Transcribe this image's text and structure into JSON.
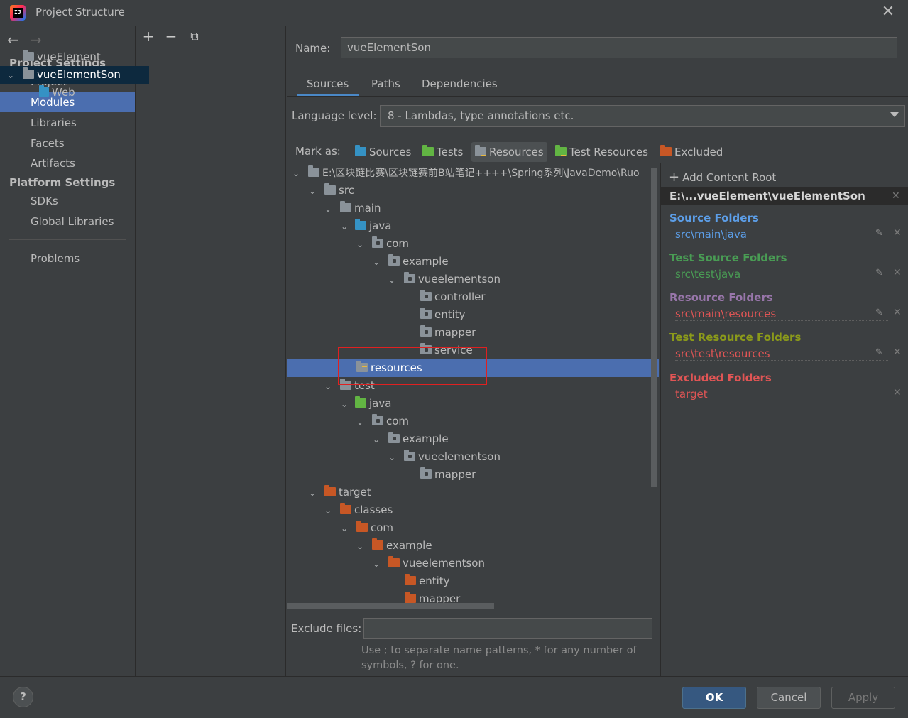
{
  "window": {
    "title": "Project Structure"
  },
  "left_nav": {
    "project_settings_header": "Project Settings",
    "project_settings_items": [
      "Project",
      "Modules",
      "Libraries",
      "Facets",
      "Artifacts"
    ],
    "platform_settings_header": "Platform Settings",
    "platform_settings_items": [
      "SDKs",
      "Global Libraries"
    ],
    "problems": "Problems",
    "selected": "Modules"
  },
  "modules": {
    "toolbar": {
      "add": "+",
      "remove": "−",
      "copy": "copy"
    },
    "items": [
      "vueElement",
      "vueElementSon",
      "Web"
    ]
  },
  "main": {
    "name_label": "Name:",
    "name_value": "vueElementSon",
    "tabs": [
      "Sources",
      "Paths",
      "Dependencies"
    ],
    "language_label": "Language level:",
    "language_value": "8 - Lambdas, type annotations etc.",
    "mark_as_label": "Mark as:",
    "mark_as": [
      "Sources",
      "Tests",
      "Resources",
      "Test Resources",
      "Excluded"
    ],
    "tree": [
      "E:\\区块链比赛\\区块链赛前B站笔记++++\\Spring系列\\JavaDemo\\Ruo",
      "src",
      "main",
      "java",
      "com",
      "example",
      "vueelementson",
      "controller",
      "entity",
      "mapper",
      "service",
      "resources",
      "test",
      "java",
      "com",
      "example",
      "vueelementson",
      "mapper",
      "target",
      "classes",
      "com",
      "example",
      "vueelementson",
      "entity",
      "mapper"
    ],
    "exclude_label": "Exclude files:",
    "exclude_value": "",
    "hint_line1": "Use ; to separate name patterns, * for any number of",
    "hint_line2": "symbols, ? for one."
  },
  "content_roots": {
    "add_label": "Add Content Root",
    "root_path": "E:\\...vueElement\\vueElementSon",
    "sections": [
      {
        "title": "Source Folders",
        "item": "src\\main\\java",
        "color": "#5c9ee8"
      },
      {
        "title": "Test Source Folders",
        "item": "src\\test\\java",
        "color": "#499c54"
      },
      {
        "title": "Resource Folders",
        "item": "src\\main\\resources",
        "color": "#9876aa"
      },
      {
        "title": "Test Resource Folders",
        "item": "src\\test\\resources",
        "color": "#8b9a1a"
      },
      {
        "title": "Excluded Folders",
        "item": "target",
        "color": "#e05555"
      }
    ]
  },
  "footer": {
    "help": "?",
    "ok": "OK",
    "cancel": "Cancel",
    "apply": "Apply"
  }
}
